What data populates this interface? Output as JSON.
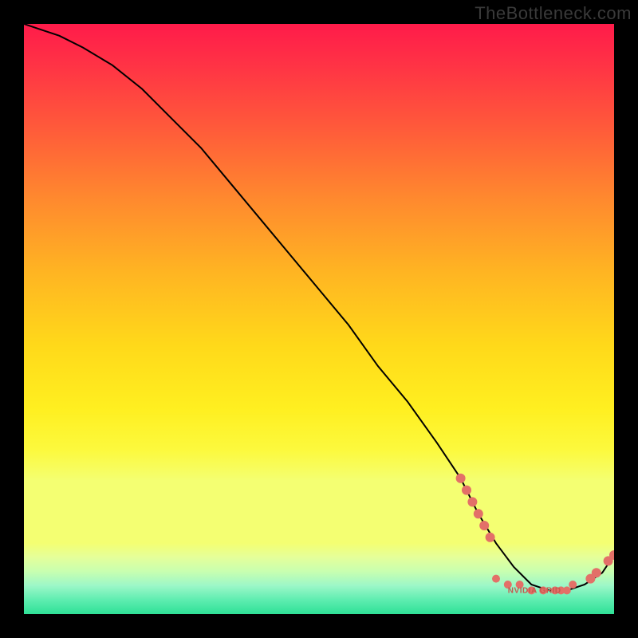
{
  "watermark": "TheBottleneck.com",
  "annotation": {
    "label": "NVIDIA GRID"
  },
  "colors": {
    "marker": "#e37068",
    "curve": "#000000",
    "frame": "#000000",
    "watermark": "#3a3a3a"
  },
  "chart_data": {
    "type": "line",
    "title": "",
    "xlabel": "",
    "ylabel": "",
    "xlim": [
      0,
      100
    ],
    "ylim": [
      0,
      100
    ],
    "grid": false,
    "legend": false,
    "series": [
      {
        "name": "bottleneck-curve",
        "x": [
          0,
          3,
          6,
          10,
          15,
          20,
          25,
          30,
          35,
          40,
          45,
          50,
          55,
          60,
          65,
          70,
          74,
          77,
          80,
          83,
          86,
          89,
          92,
          95,
          98,
          100
        ],
        "y": [
          100,
          99,
          98,
          96,
          93,
          89,
          84,
          79,
          73,
          67,
          61,
          55,
          49,
          42,
          36,
          29,
          23,
          17,
          12,
          8,
          5,
          4,
          4,
          5,
          7,
          10
        ]
      }
    ],
    "markers": {
      "left_cluster": {
        "x": [
          74,
          75,
          76,
          77,
          78,
          79
        ],
        "y": [
          23,
          21,
          19,
          17,
          15,
          13
        ]
      },
      "bottom_cluster": {
        "x": [
          80,
          82,
          84,
          86,
          88,
          90,
          91,
          92,
          93
        ],
        "y": [
          6,
          5,
          5,
          4,
          4,
          4,
          4,
          4,
          5
        ]
      },
      "right_cluster": {
        "x": [
          96,
          97,
          99,
          100
        ],
        "y": [
          6,
          7,
          9,
          10
        ]
      }
    },
    "background": {
      "type": "vertical-gradient",
      "stops": [
        {
          "pos": 0,
          "color": "#ff1b4a"
        },
        {
          "pos": 50,
          "color": "#ffd91a"
        },
        {
          "pos": 88,
          "color": "#f4ff72"
        },
        {
          "pos": 100,
          "color": "#2fe197"
        }
      ]
    }
  }
}
